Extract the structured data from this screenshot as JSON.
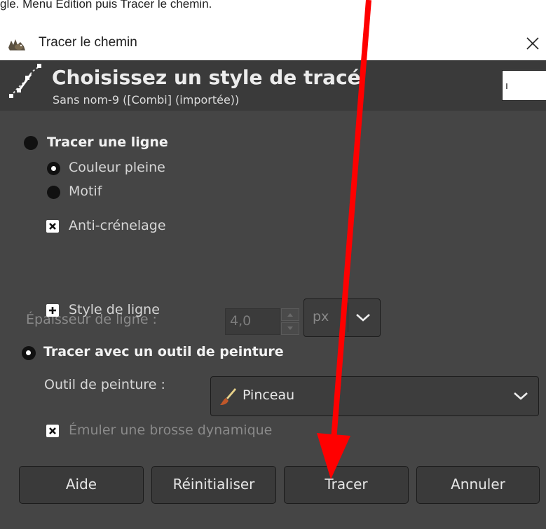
{
  "caption": "gle. Menu Edition puis Tracer le chemin.",
  "window": {
    "title": "Tracer le chemin"
  },
  "header": {
    "title": "Choisissez un style de tracé",
    "subtitle": "Sans nom-9 ([Combi] (importée))"
  },
  "stroke_line": {
    "label": "Tracer une ligne",
    "solid_color_label": "Couleur pleine",
    "pattern_label": "Motif",
    "antialias_label": "Anti-crénelage",
    "antialias_checked": true,
    "line_width_label": "Épaisseur de ligne :",
    "line_width_value": "4,0",
    "unit_value": "px",
    "line_style_label": "Style de ligne"
  },
  "stroke_paint": {
    "label": "Tracer avec un outil de peinture",
    "selected": true,
    "tool_label": "Outil de peinture :",
    "tool_value": "Pinceau",
    "emulate_label": "Émuler une brosse dynamique",
    "emulate_checked": true
  },
  "buttons": {
    "help": "Aide",
    "reset": "Réinitialiser",
    "stroke": "Tracer",
    "cancel": "Annuler"
  },
  "colors": {
    "dialog_bg": "#454545",
    "header_bg": "#3a3a3a",
    "annotation_arrow": "#ff0000"
  },
  "icons": {
    "app": "gimp-wilber-icon",
    "header": "path-stroke-icon",
    "close": "close-icon",
    "brush": "paintbrush-icon"
  }
}
